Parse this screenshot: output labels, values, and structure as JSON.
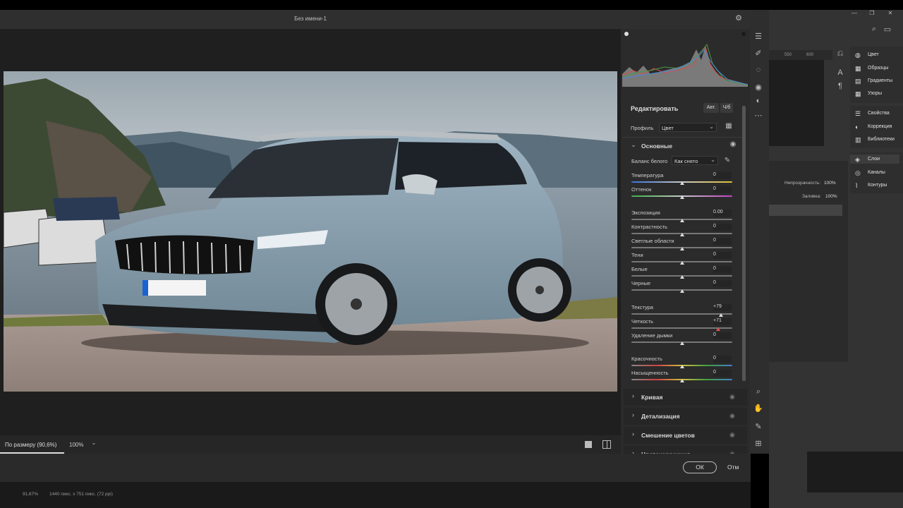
{
  "window": {
    "title": "Без имени-1"
  },
  "panel": {
    "edit_title": "Редактировать",
    "auto_btn": "Авт.",
    "bw_btn": "Ч/б",
    "profile_label": "Профиль",
    "profile_value": "Цвет",
    "basic_title": "Основные",
    "wb_label": "Баланс белого",
    "wb_value": "Как снято",
    "sliders": [
      {
        "label": "Температура",
        "value": "0"
      },
      {
        "label": "Оттенок",
        "value": "0"
      },
      {
        "label": "Экспозиция",
        "value": "0.00"
      },
      {
        "label": "Контрастность",
        "value": "0"
      },
      {
        "label": "Светлые области",
        "value": "0"
      },
      {
        "label": "Тени",
        "value": "0"
      },
      {
        "label": "Белые",
        "value": "0"
      },
      {
        "label": "Черные",
        "value": "0"
      },
      {
        "label": "Текстура",
        "value": "+79"
      },
      {
        "label": "Четкость",
        "value": "+71"
      },
      {
        "label": "Удаление дымки",
        "value": "0"
      },
      {
        "label": "Красочность",
        "value": "0"
      },
      {
        "label": "Насыщенность",
        "value": "0"
      }
    ],
    "sections": [
      "Кривая",
      "Детализация",
      "Смешение цветов",
      "Цветокоррекция"
    ]
  },
  "bottom": {
    "fit_label": "По размеру (90,6%)",
    "zoom_label": "100%"
  },
  "footer": {
    "ok_label": "ОК",
    "cancel_label": "Отм"
  },
  "status": {
    "zoom": "91,67%",
    "doc_info": "1440 пикс. x 751 пикс. (72 ppi)"
  },
  "host": {
    "ruler": [
      "550",
      "600"
    ],
    "right_panel_top": [
      "Цвет",
      "Образцы",
      "Градиенты",
      "Узоры"
    ],
    "right_panel_mid": [
      "Свойства",
      "Коррекция",
      "Библиотеки"
    ],
    "right_panel_bottom": [
      "Слои",
      "Каналы",
      "Контуры"
    ],
    "opacity_label": "Непрозрачность:",
    "opacity_value": "100%",
    "fill_label": "Заливка:",
    "fill_value": "100%"
  },
  "colors": {
    "panel_bg": "#2b2b2b",
    "accent_thumb": "#e05050"
  }
}
